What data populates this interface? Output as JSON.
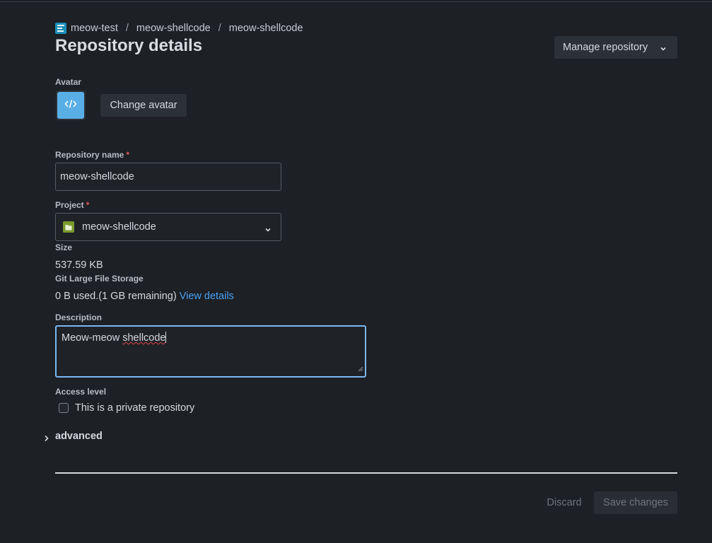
{
  "breadcrumb": {
    "items": [
      "meow-test",
      "meow-shellcode",
      "meow-shellcode"
    ],
    "separator": "/",
    "org_icon": "organization-icon"
  },
  "header": {
    "title": "Repository details",
    "manage_label": "Manage repository"
  },
  "avatar": {
    "label": "Avatar",
    "icon": "code-icon",
    "change_label": "Change avatar"
  },
  "fields": {
    "repo_name": {
      "label": "Repository name",
      "required": "*",
      "value": "meow-shellcode"
    },
    "project": {
      "label": "Project",
      "required": "*",
      "value": "meow-shellcode",
      "icon": "folder-icon"
    },
    "size": {
      "label": "Size",
      "value": "537.59 KB"
    },
    "lfs": {
      "label": "Git Large File Storage",
      "usage": "0 B used.(1 GB remaining)",
      "link": "View details"
    },
    "description": {
      "label": "Description",
      "value_plain": "Meow-meow ",
      "value_misspelled": "shellcode"
    },
    "access": {
      "label": "Access level",
      "checkbox_label": "This is a private repository",
      "checked": false
    }
  },
  "advanced": {
    "label": "advanced"
  },
  "footer": {
    "discard_label": "Discard",
    "save_label": "Save changes"
  },
  "colors": {
    "background": "#1d2025",
    "accent_link": "#4aa1f3",
    "avatar_bg": "#5aaee6",
    "project_icon": "#7a9a2c",
    "focus_border": "#7ab7f0",
    "required": "#e05b5b"
  }
}
